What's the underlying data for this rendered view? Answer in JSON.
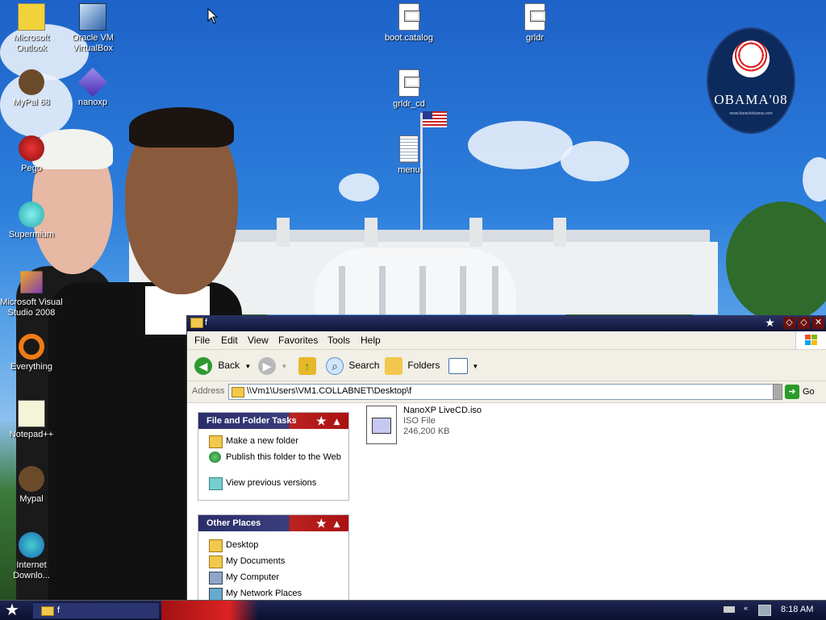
{
  "desktop": {
    "icons": [
      {
        "label": "Microsoft Outlook",
        "icon": "outlook-icon"
      },
      {
        "label": "Oracle VM VirtualBox",
        "icon": "virtualbox-icon"
      },
      {
        "label": "MyPal 68",
        "icon": "mypal-icon"
      },
      {
        "label": "nanoxp",
        "icon": "cube-icon"
      },
      {
        "label": "Pego",
        "icon": "pego-icon"
      },
      {
        "label": "Supermium",
        "icon": "supermium-icon"
      },
      {
        "label": "Microsoft Visual Studio 2008",
        "icon": "visual-studio-icon"
      },
      {
        "label": "Everything",
        "icon": "everything-icon"
      },
      {
        "label": "Notepad++",
        "icon": "notepadpp-icon"
      },
      {
        "label": "Mypal",
        "icon": "mypal-icon"
      },
      {
        "label": "Internet Downlo...",
        "icon": "internet-download-manager-icon"
      },
      {
        "label": "boot.catalog",
        "icon": "file-icon"
      },
      {
        "label": "grldr",
        "icon": "file-icon"
      },
      {
        "label": "grldr_cd",
        "icon": "file-icon"
      },
      {
        "label": "menu",
        "icon": "text-file-icon"
      }
    ],
    "badge_text": "OBAMA'08",
    "badge_url": "www.barackobama.com"
  },
  "window": {
    "title": "f",
    "menu": [
      "File",
      "Edit",
      "View",
      "Favorites",
      "Tools",
      "Help"
    ],
    "toolbar": {
      "back": "Back",
      "search": "Search",
      "folders": "Folders"
    },
    "address": {
      "label": "Address",
      "path": "\\\\Vm1\\Users\\VM1.COLLABNET\\Desktop\\f",
      "go": "Go"
    },
    "tasks_panel": {
      "title": "File and Folder Tasks",
      "items": [
        "Make a new folder",
        "Publish this folder to the Web",
        "View previous versions"
      ]
    },
    "places_panel": {
      "title": "Other Places",
      "items": [
        "Desktop",
        "My Documents",
        "My Computer",
        "My Network Places"
      ]
    },
    "file": {
      "name": "NanoXP LiveCD.iso",
      "type": "ISO File",
      "size": "246,200 KB"
    }
  },
  "taskbar": {
    "task_label": "f",
    "clock": "8:18 AM"
  },
  "colors": {
    "titlebar": "#1b2250",
    "panel_red": "#b22222",
    "panel_blue": "#2a2e6a"
  }
}
